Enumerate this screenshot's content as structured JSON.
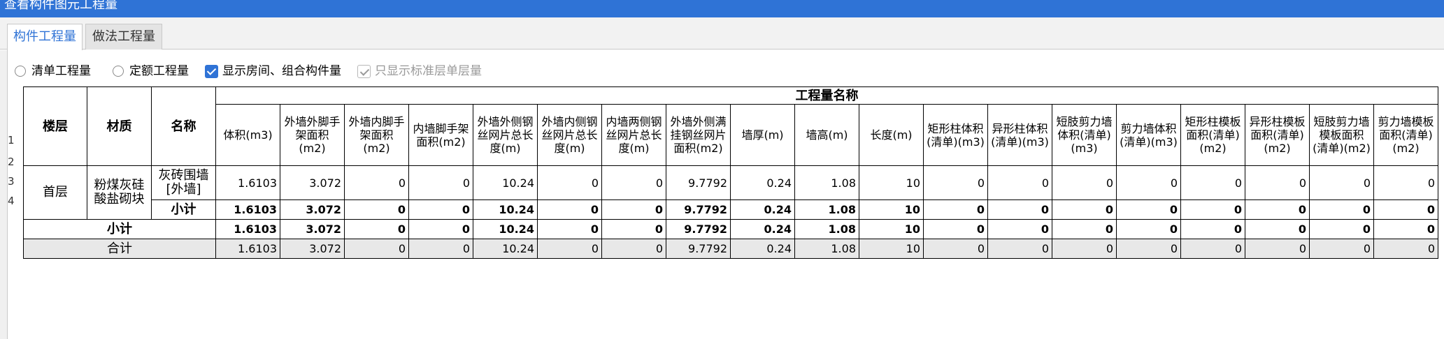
{
  "window": {
    "title": "查看构件图元工程量"
  },
  "tabs": [
    {
      "label": "构件工程量",
      "active": true
    },
    {
      "label": "做法工程量",
      "active": false
    }
  ],
  "options": {
    "radio_bill": "清单工程量",
    "radio_quota": "定额工程量",
    "show_rooms": "显示房间、组合构件量",
    "show_std_floor": "只显示标准层单层量"
  },
  "colors": {
    "title_bar": "#2f73d6",
    "accent": "#2f73d6",
    "total_row_bg": "#e8e8e8"
  },
  "table": {
    "group_header": "工程量名称",
    "fixed_headers": [
      "楼层",
      "材质",
      "名称"
    ],
    "columns": [
      "体积(m3)",
      "外墙外脚手架面积(m2)",
      "外墙内脚手架面积(m2)",
      "内墙脚手架面积(m2)",
      "外墙外侧钢丝网片总长度(m)",
      "外墙内侧钢丝网片总长度(m)",
      "内墙两侧钢丝网片总长度(m)",
      "外墙外侧满挂钢丝网片面积(m2)",
      "墙厚(m)",
      "墙高(m)",
      "长度(m)",
      "矩形柱体积(清单)(m3)",
      "异形柱体积(清单)(m3)",
      "短肢剪力墙体积(清单)(m3)",
      "剪力墙体积(清单)(m3)",
      "矩形柱模板面积(清单)(m2)",
      "异形柱模板面积(清单)(m2)",
      "短肢剪力墙模板面积(清单)(m2)",
      "剪力墙模板面积(清单)(m2)"
    ],
    "row_numbers": [
      "1",
      "2",
      "3",
      "4"
    ],
    "floor": "首层",
    "material": "粉煤灰硅酸盐砌块",
    "name": "灰砖围墙[外墙]",
    "subtotal_label": "小计",
    "floor_subtotal_label": "小计",
    "total_label": "合计",
    "values": {
      "row1": [
        "1.6103",
        "3.072",
        "0",
        "0",
        "10.24",
        "0",
        "0",
        "9.7792",
        "0.24",
        "1.08",
        "10",
        "0",
        "0",
        "0",
        "0",
        "0",
        "0",
        "0",
        "0"
      ],
      "row2": [
        "1.6103",
        "3.072",
        "0",
        "0",
        "10.24",
        "0",
        "0",
        "9.7792",
        "0.24",
        "1.08",
        "10",
        "0",
        "0",
        "0",
        "0",
        "0",
        "0",
        "0",
        "0"
      ],
      "row3": [
        "1.6103",
        "3.072",
        "0",
        "0",
        "10.24",
        "0",
        "0",
        "9.7792",
        "0.24",
        "1.08",
        "10",
        "0",
        "0",
        "0",
        "0",
        "0",
        "0",
        "0",
        "0"
      ],
      "row4": [
        "1.6103",
        "3.072",
        "0",
        "0",
        "10.24",
        "0",
        "0",
        "9.7792",
        "0.24",
        "1.08",
        "10",
        "0",
        "0",
        "0",
        "0",
        "0",
        "0",
        "0",
        "0"
      ]
    }
  }
}
